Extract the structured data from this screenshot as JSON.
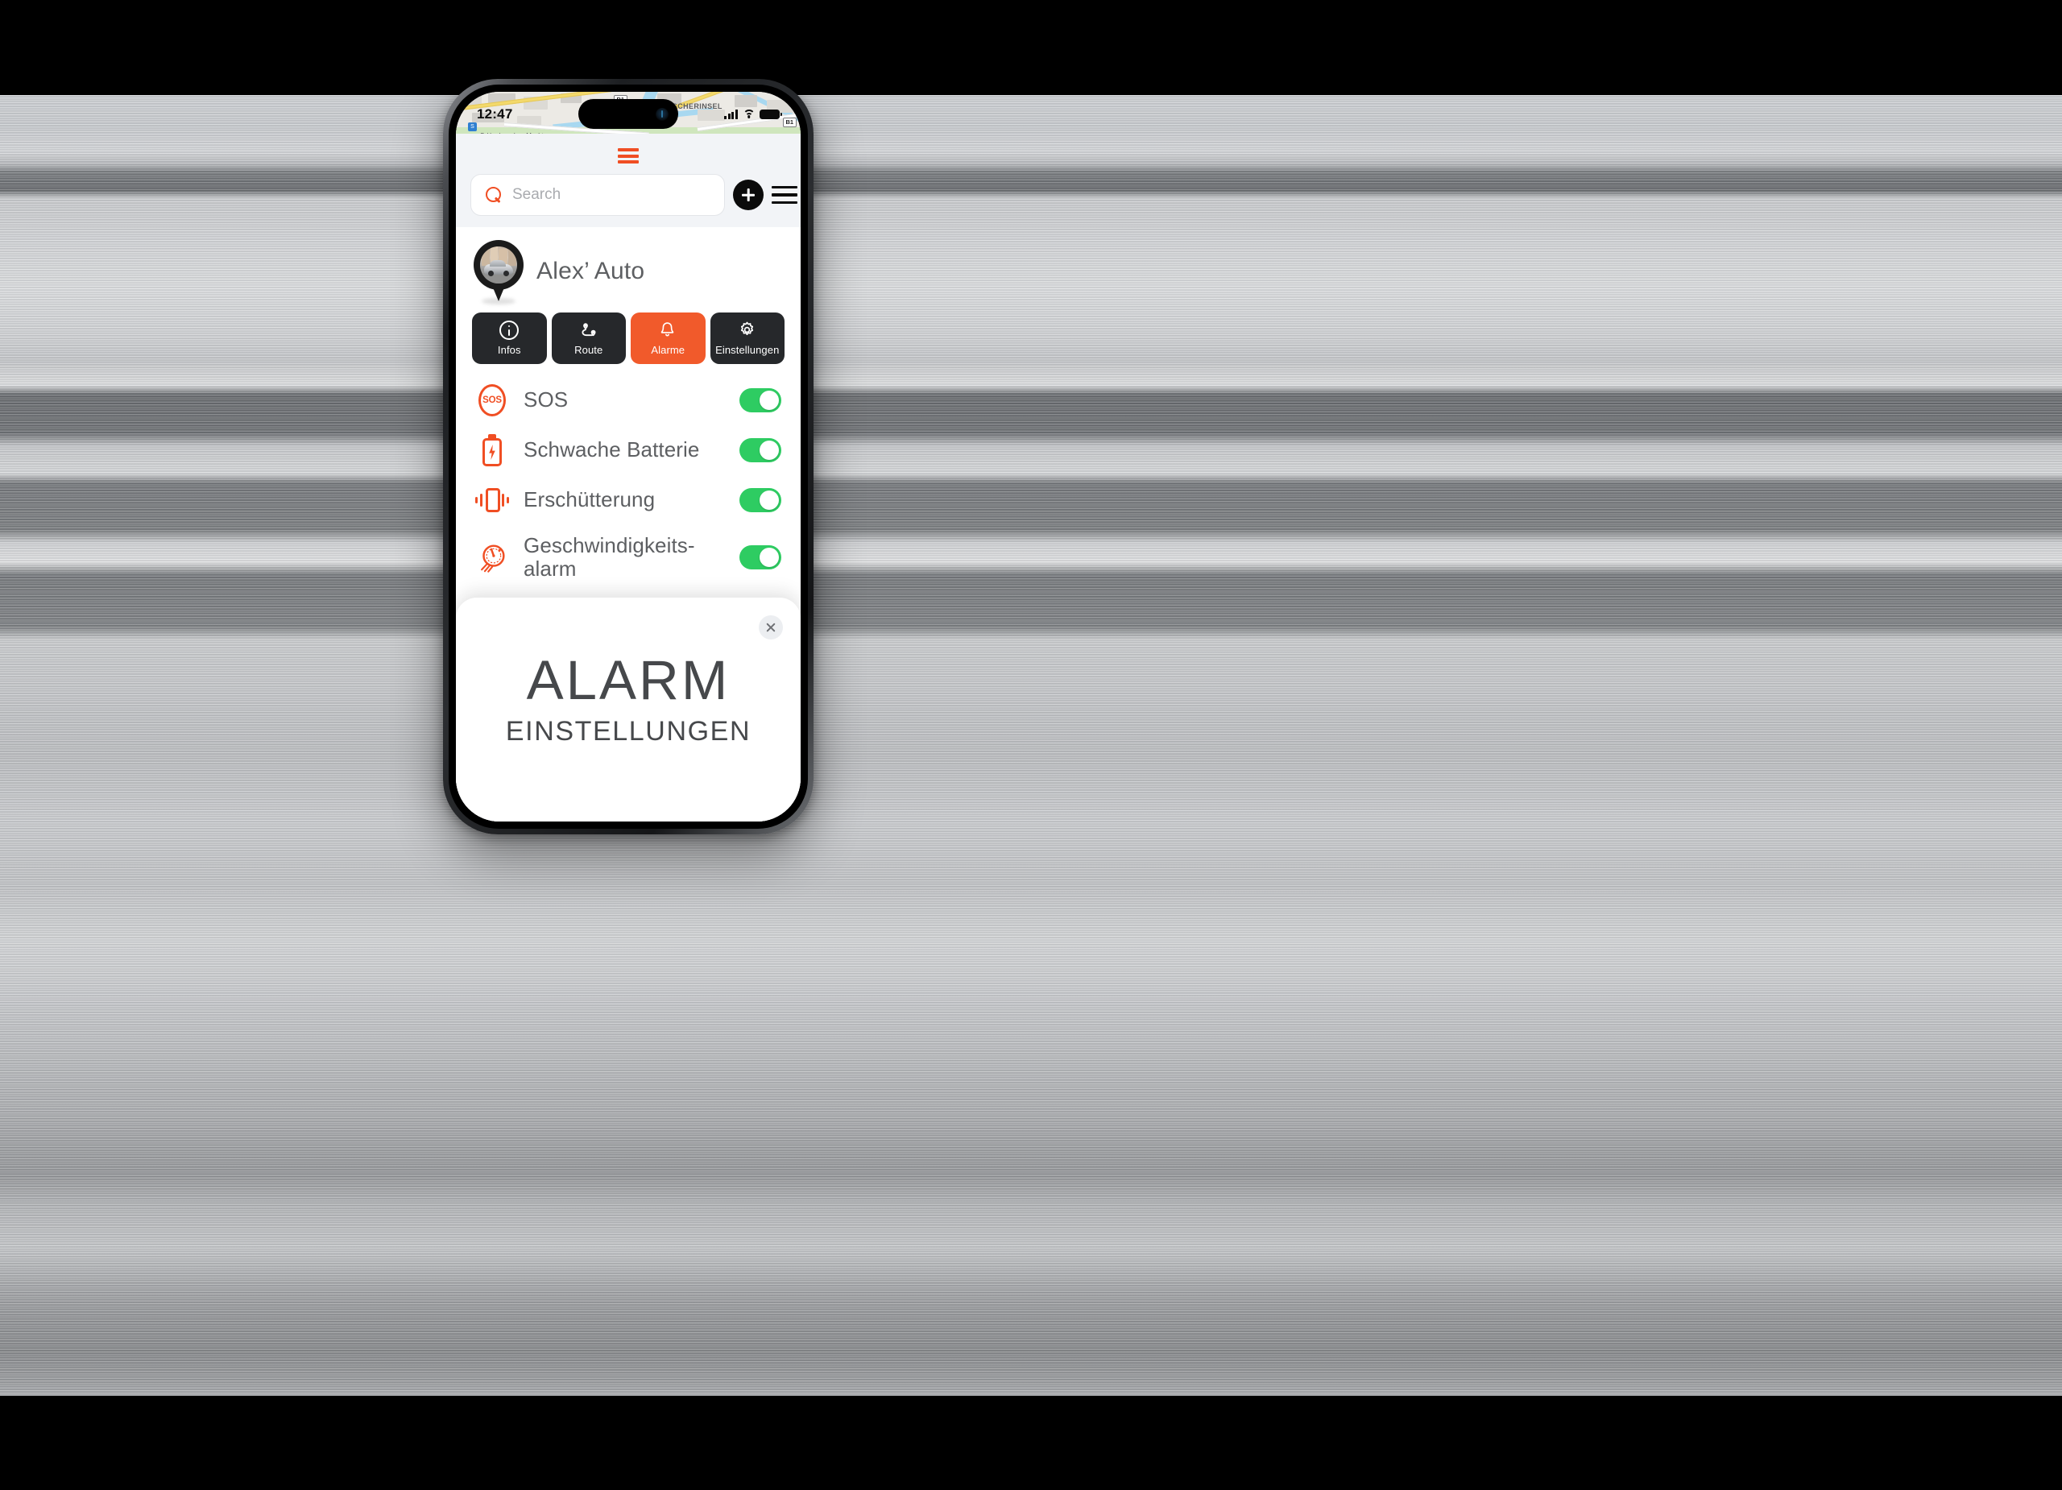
{
  "statusbar": {
    "time": "12:47",
    "signal_icon": "cellular-signal-icon",
    "wifi_icon": "wifi-icon",
    "battery_icon": "battery-icon"
  },
  "map": {
    "labels": [
      {
        "text": "FISCHERINSEL"
      },
      {
        "text": "S Hackescher Markt"
      }
    ],
    "shields": [
      "B1",
      "B1"
    ],
    "transit_badge": "S"
  },
  "sheet": {
    "grabber_icon": "drag-handle-icon",
    "search": {
      "placeholder": "Search",
      "value": "",
      "icon": "search-icon"
    },
    "add_button": {
      "icon": "plus-icon",
      "label": "+"
    },
    "menu_button": {
      "icon": "hamburger-menu-icon"
    }
  },
  "device": {
    "name": "Alex’ Auto",
    "avatar_icon": "map-pin-avatar"
  },
  "actions": [
    {
      "label": "Infos",
      "icon": "info-icon",
      "active": false
    },
    {
      "label": "Route",
      "icon": "route-icon",
      "active": false
    },
    {
      "label": "Alarme",
      "icon": "bell-icon",
      "active": true
    },
    {
      "label": "Einstellungen",
      "icon": "gear-icon",
      "active": false
    }
  ],
  "alarms": [
    {
      "label": "SOS",
      "icon": "sos-icon",
      "enabled": true,
      "toggle_state": "on"
    },
    {
      "label": "Schwache Batterie",
      "icon": "low-battery-icon",
      "enabled": true,
      "toggle_state": "on"
    },
    {
      "label": "Erschütterung",
      "icon": "vibration-icon",
      "enabled": true,
      "toggle_state": "on"
    },
    {
      "label": "Geschwindigkeits-\nalarm",
      "icon": "speedometer-icon",
      "enabled": true,
      "toggle_state": "on"
    }
  ],
  "card": {
    "title": "ALARM",
    "subtitle": "EINSTELLUNGEN",
    "close_icon": "close-icon"
  },
  "colors": {
    "accent_orange": "#f15a2b",
    "brand_orange": "#f04e23",
    "toggle_green": "#2ecc62",
    "dark_button": "#26282b",
    "sheet_bg": "#f2f4f7",
    "text_grey": "#5d5f62"
  }
}
